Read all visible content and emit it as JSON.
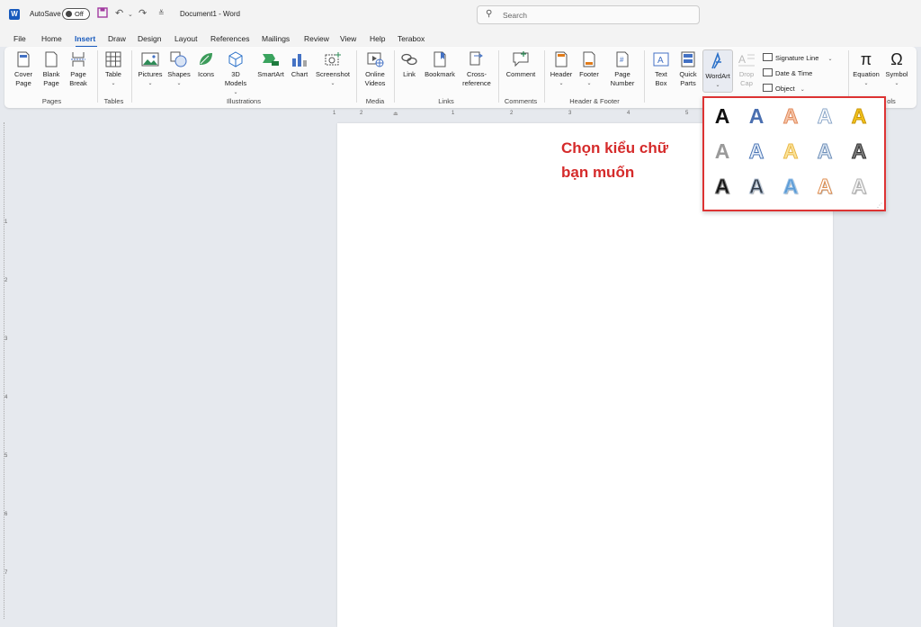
{
  "titlebar": {
    "autosave_label": "AutoSave",
    "autosave_state": "Off",
    "doc_title": "Document1 - Word",
    "search_placeholder": "Search",
    "quick_access_icons": [
      "save-icon",
      "undo-icon",
      "redo-icon",
      "customize-icon"
    ]
  },
  "tabs": [
    "File",
    "Home",
    "Insert",
    "Draw",
    "Design",
    "Layout",
    "References",
    "Mailings",
    "Review",
    "View",
    "Help",
    "Terabox"
  ],
  "active_tab": "Insert",
  "ribbon": {
    "pages": {
      "label": "Pages",
      "cover_page": [
        "Cover",
        "Page"
      ],
      "blank_page": [
        "Blank",
        "Page"
      ],
      "page_break": [
        "Page",
        "Break"
      ]
    },
    "tables": {
      "label": "Tables",
      "table": "Table"
    },
    "illustrations": {
      "label": "Illustrations",
      "pictures": "Pictures",
      "shapes": "Shapes",
      "icons": "Icons",
      "models": [
        "3D",
        "Models"
      ],
      "smartart": "SmartArt",
      "chart": "Chart",
      "screenshot": "Screenshot"
    },
    "media": {
      "label": "Media",
      "online_videos": [
        "Online",
        "Videos"
      ]
    },
    "links": {
      "label": "Links",
      "link": "Link",
      "bookmark": "Bookmark",
      "cross_reference": [
        "Cross-",
        "reference"
      ]
    },
    "comments": {
      "label": "Comments",
      "comment": "Comment"
    },
    "header_footer": {
      "label": "Header & Footer",
      "header": "Header",
      "footer": "Footer",
      "page_number": [
        "Page",
        "Number"
      ]
    },
    "text": {
      "text_box": [
        "Text",
        "Box"
      ],
      "quick_parts": [
        "Quick",
        "Parts"
      ],
      "wordart": "WordArt",
      "drop_cap": [
        "Drop",
        "Cap"
      ],
      "signature_line": "Signature Line",
      "date_time": "Date & Time",
      "object": "Object"
    },
    "symbols": {
      "label": "ols",
      "equation": "Equation",
      "symbol": "Symbol"
    }
  },
  "ruler_top_numbers": [
    "1",
    "2",
    "1",
    "1",
    "2",
    "3",
    "4",
    "5"
  ],
  "ruler_left_numbers": [
    "1",
    "2",
    "3",
    "4",
    "5",
    "6",
    "7"
  ],
  "annotation": [
    "Chọn kiểu chữ",
    "bạn muốn"
  ],
  "wordart_letter": "A",
  "wordart_styles": [
    {
      "fill": "#111111",
      "stroke": "none"
    },
    {
      "fill": "#4a6fb0",
      "stroke": "none"
    },
    {
      "fill": "#f6c5a8",
      "stroke": "#e08a5c"
    },
    {
      "fill": "#ffffff",
      "stroke": "#8aa6c8"
    },
    {
      "fill": "#f2c21b",
      "stroke": "#c8960a"
    },
    {
      "fill": "#9a9a9a",
      "stroke": "none"
    },
    {
      "fill": "#e8f0fa",
      "stroke": "#4a74b4"
    },
    {
      "fill": "#fbe39a",
      "stroke": "#e8b84a"
    },
    {
      "fill": "#dce6f2",
      "stroke": "#6e8fb8"
    },
    {
      "fill": "#7a7a7a",
      "stroke": "#333333"
    },
    {
      "fill": "#111111",
      "stroke": "#777777"
    },
    {
      "fill": "#333d4a",
      "stroke": "#b8c6d8"
    },
    {
      "fill": "#5b9bd5",
      "stroke": "#9cc3e8"
    },
    {
      "fill": "#ffffff",
      "stroke": "#e08c4c"
    },
    {
      "fill": "#f4f4f4",
      "stroke": "#b0b0b0"
    }
  ]
}
